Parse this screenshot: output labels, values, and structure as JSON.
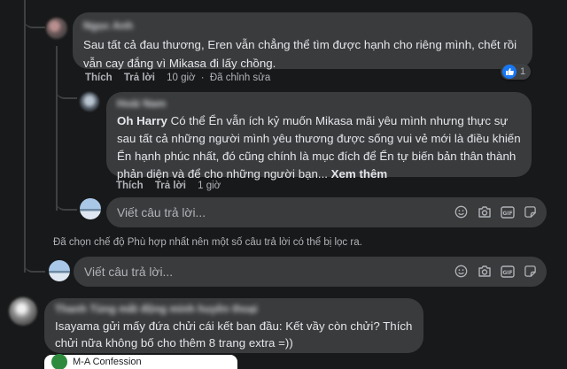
{
  "comments": [
    {
      "author": "Ngọc Anh",
      "text": "Sau tất cả đau thương, Eren vẫn chẳng thể tìm được hạnh cho riêng mình, chết rồi vẫn cay đắng vì Mikasa đi lấy chồng.",
      "like_label": "Thích",
      "reply_label": "Trả lời",
      "time": "10 giờ",
      "edited": "Đã chỉnh sửa",
      "reaction_count": "1"
    },
    {
      "author": "Hoài Nam",
      "mention": "Oh Harry",
      "text": " Có thể Ển vẫn ích kỷ muốn Mikasa mãi yêu mình nhưng thực sự sau tất cả những người mình yêu thương được sống vui vẻ mới là điều khiến Ển hạnh phúc nhất, đó cũng chính là mục đích để Ển tự biến bản thân thành phản diện và để cho những người bạn...",
      "see_more": "Xem thêm",
      "like_label": "Thích",
      "reply_label": "Trả lời",
      "time": "1 giờ"
    },
    {
      "author": "Thanh Tùng mất động minh huyền thoại",
      "text": "Isayama gửi mấy đứa chửi cái kết ban đầu: Kết vầy còn chửi? Thích chửi nữa không bố cho thêm 8 trang extra =))"
    }
  ],
  "reply_placeholder": "Viết câu trả lời...",
  "filter_notice": "Đã chọn chế độ Phù hợp nhất nên một số câu trả lời có thể bị lọc ra.",
  "preview": {
    "title": "M-A Confession"
  },
  "icons": [
    "emoji-icon",
    "camera-icon",
    "gif-icon",
    "sticker-icon"
  ],
  "colors": {
    "background": "#18191a",
    "bubble": "#3a3b3c",
    "like": "#1877f2"
  }
}
